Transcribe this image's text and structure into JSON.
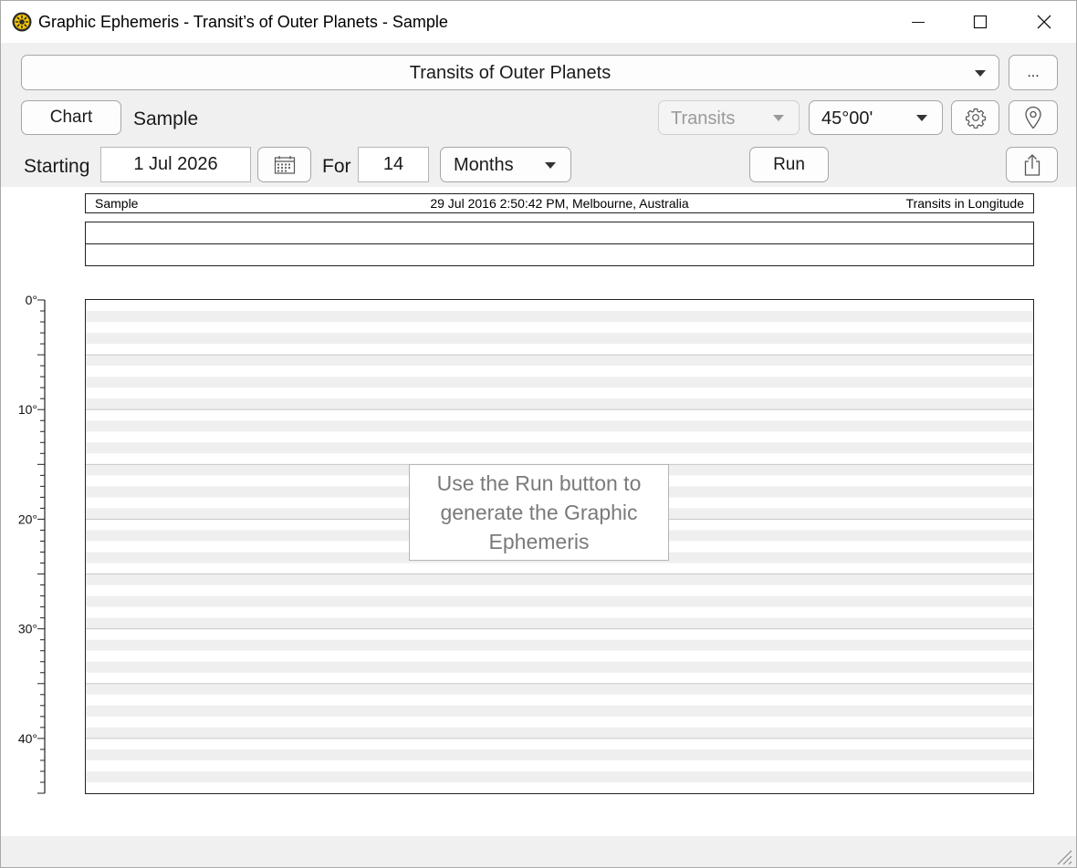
{
  "window": {
    "title": "Graphic Ephemeris - Transit’s of Outer Planets - Sample",
    "icon": "sun-app-icon",
    "controls": [
      "minimize",
      "maximize",
      "close"
    ]
  },
  "toolbar": {
    "report_select": {
      "value": "Transits of Outer Planets"
    },
    "more_label": "...",
    "chart_button": "Chart",
    "chart_name": "Sample",
    "mode_select": {
      "value": "Transits",
      "disabled": true
    },
    "harmonic_select": {
      "value": "45°00'"
    },
    "settings_icon": "gear-icon",
    "location_icon": "map-pin-icon",
    "starting_label": "Starting",
    "start_date": "1 Jul 2026",
    "calendar_icon": "calendar-icon",
    "for_label": "For",
    "duration_value": "14",
    "unit_select": {
      "value": "Months"
    },
    "run_button": "Run",
    "export_icon": "share-export-icon"
  },
  "report": {
    "header_left": "Sample",
    "header_center": "29 Jul 2016 2:50:42 PM, Melbourne, Australia",
    "header_right": "Transits in Longitude"
  },
  "ephemeris": {
    "axis_labels": [
      "0°",
      "10°",
      "20°",
      "30°",
      "40°"
    ],
    "axis_range_degrees": [
      0,
      45
    ],
    "message": "Use the Run button to generate the Graphic Ephemeris"
  },
  "colors": {
    "toolbar_bg": "#f0f0f0",
    "stripe": "#efefef",
    "gridline": "#c8c8c8",
    "message_text": "#7a7a7a"
  }
}
